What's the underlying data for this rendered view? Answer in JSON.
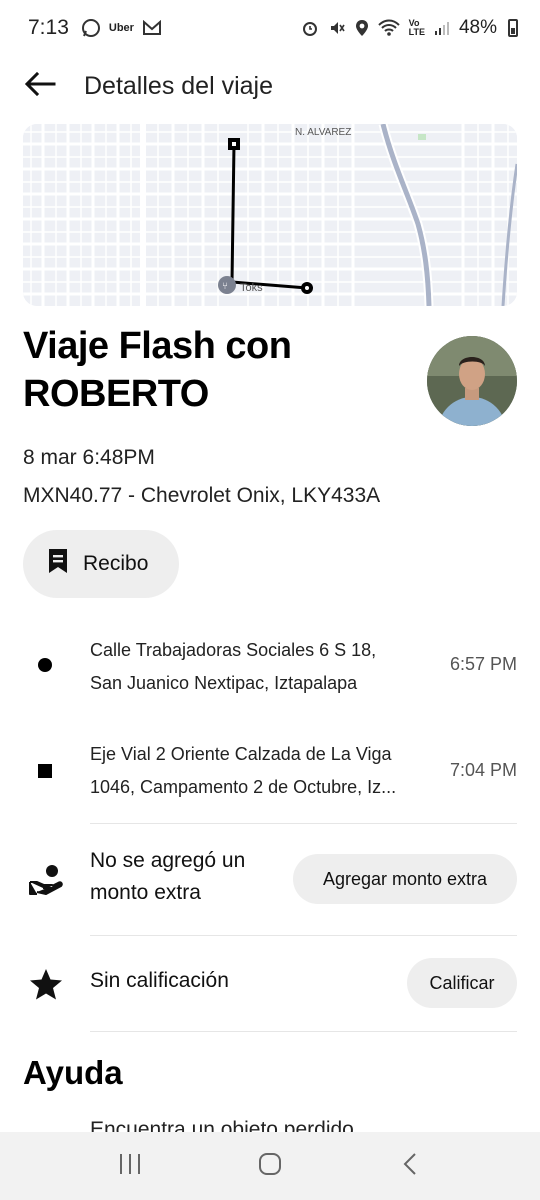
{
  "status_bar": {
    "time": "7:13",
    "app_label": "Uber",
    "battery": "48%"
  },
  "header": {
    "title": "Detalles del viaje"
  },
  "map": {
    "street_label": "N. ALVAREZ",
    "poi_label": "Toks"
  },
  "trip": {
    "title": "Viaje Flash con ROBERTO",
    "date": "8 mar 6:48PM",
    "fare_vehicle": "MXN40.77 - Chevrolet Onix, LKY433A",
    "receipt_label": "Recibo"
  },
  "stops": [
    {
      "line1": "Calle Trabajadoras Sociales 6 S 18,",
      "line2": "San Juanico Nextipac, Iztapalapa",
      "time": "6:57 PM"
    },
    {
      "line1": "Eje Vial 2 Oriente Calzada de La Viga",
      "line2": "1046, Campamento 2 de Octubre, Iz...",
      "time": "7:04 PM"
    }
  ],
  "tip": {
    "label": "No se agregó un monto extra",
    "button": "Agregar monto extra"
  },
  "rating": {
    "label": "Sin calificación",
    "button": "Calificar"
  },
  "help": {
    "title": "Ayuda",
    "item": "Encuentra un objeto perdido"
  },
  "icons": {
    "back": "arrow-left-icon",
    "receipt": "receipt-icon",
    "tip": "hand-coin-icon",
    "rating": "star-icon"
  }
}
